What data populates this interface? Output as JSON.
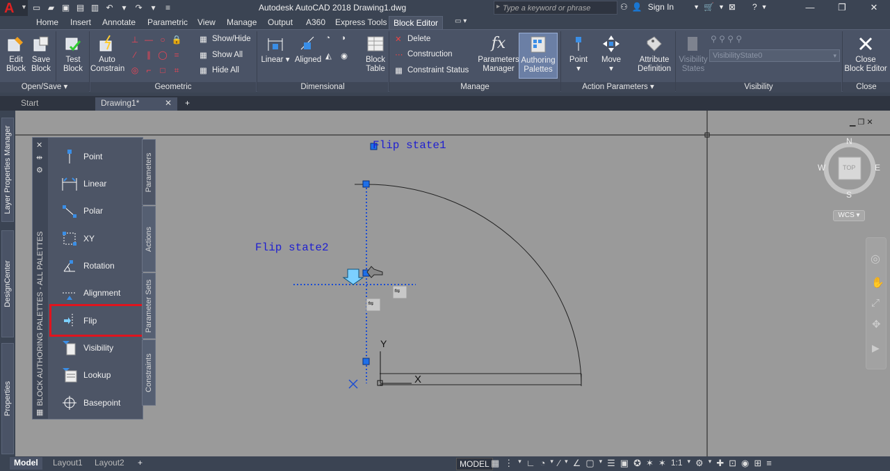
{
  "window": {
    "title": "Autodesk AutoCAD 2018    Drawing1.dwg",
    "search_placeholder": "Type a keyword or phrase",
    "sign_in": "Sign In"
  },
  "ribbon_tabs": [
    "Home",
    "Insert",
    "Annotate",
    "Parametric",
    "View",
    "Manage",
    "Output",
    "A360",
    "Express Tools",
    "Block Editor"
  ],
  "active_ribbon_tab": "Block Editor",
  "ribbon": {
    "open_save": {
      "edit_block": [
        "Edit",
        "Block"
      ],
      "save_block": [
        "Save",
        "Block"
      ],
      "title": "Open/Save"
    },
    "test_block": [
      "Test",
      "Block"
    ],
    "geometric": {
      "auto_constrain": [
        "Auto",
        "Constrain"
      ],
      "show_hide": "Show/Hide",
      "show_all": "Show All",
      "hide_all": "Hide All",
      "title": "Geometric"
    },
    "dimensional": {
      "linear": "Linear",
      "aligned": "Aligned",
      "title": "Dimensional"
    },
    "manage": {
      "block_table": [
        "Block",
        "Table"
      ],
      "delete": "Delete",
      "construction": "Construction",
      "constraint_status": "Constraint Status",
      "parameters_manager": [
        "Parameters",
        "Manager"
      ],
      "authoring_palettes": [
        "Authoring",
        "Palettes"
      ],
      "title": "Manage"
    },
    "action_parameters": {
      "point": "Point",
      "move": "Move",
      "attribute_definition": [
        "Attribute",
        "Definition"
      ],
      "title": "Action Parameters"
    },
    "visibility": {
      "visibility_states": [
        "Visibility",
        "States"
      ],
      "selected_state": "VisibilityState0",
      "title": "Visibility"
    },
    "close": {
      "close_block_editor": [
        "Close",
        "Block Editor"
      ],
      "title": "Close"
    }
  },
  "file_tabs": [
    "Start",
    "Drawing1*"
  ],
  "left_palettes": [
    "Layer Properties Manager",
    "DesignCenter",
    "Properties"
  ],
  "palette": {
    "title": "BLOCK AUTHORING PALETTES - ALL PALETTES",
    "items": [
      "Point",
      "Linear",
      "Polar",
      "XY",
      "Rotation",
      "Alignment",
      "Flip",
      "Visibility",
      "Lookup",
      "Basepoint"
    ],
    "selected": "Flip",
    "tabs": [
      "Parameters",
      "Actions",
      "Parameter Sets",
      "Constraints"
    ]
  },
  "drawing": {
    "flip_state1": "Flip state1",
    "flip_state2": "Flip state2",
    "axis_x": "X",
    "axis_y": "Y"
  },
  "viewcube": {
    "n": "N",
    "s": "S",
    "e": "E",
    "w": "W",
    "face": "TOP",
    "wcs": "WCS"
  },
  "layout_tabs": [
    "Model",
    "Layout1",
    "Layout2"
  ],
  "status": {
    "model": "MODEL",
    "scale": "1:1"
  }
}
